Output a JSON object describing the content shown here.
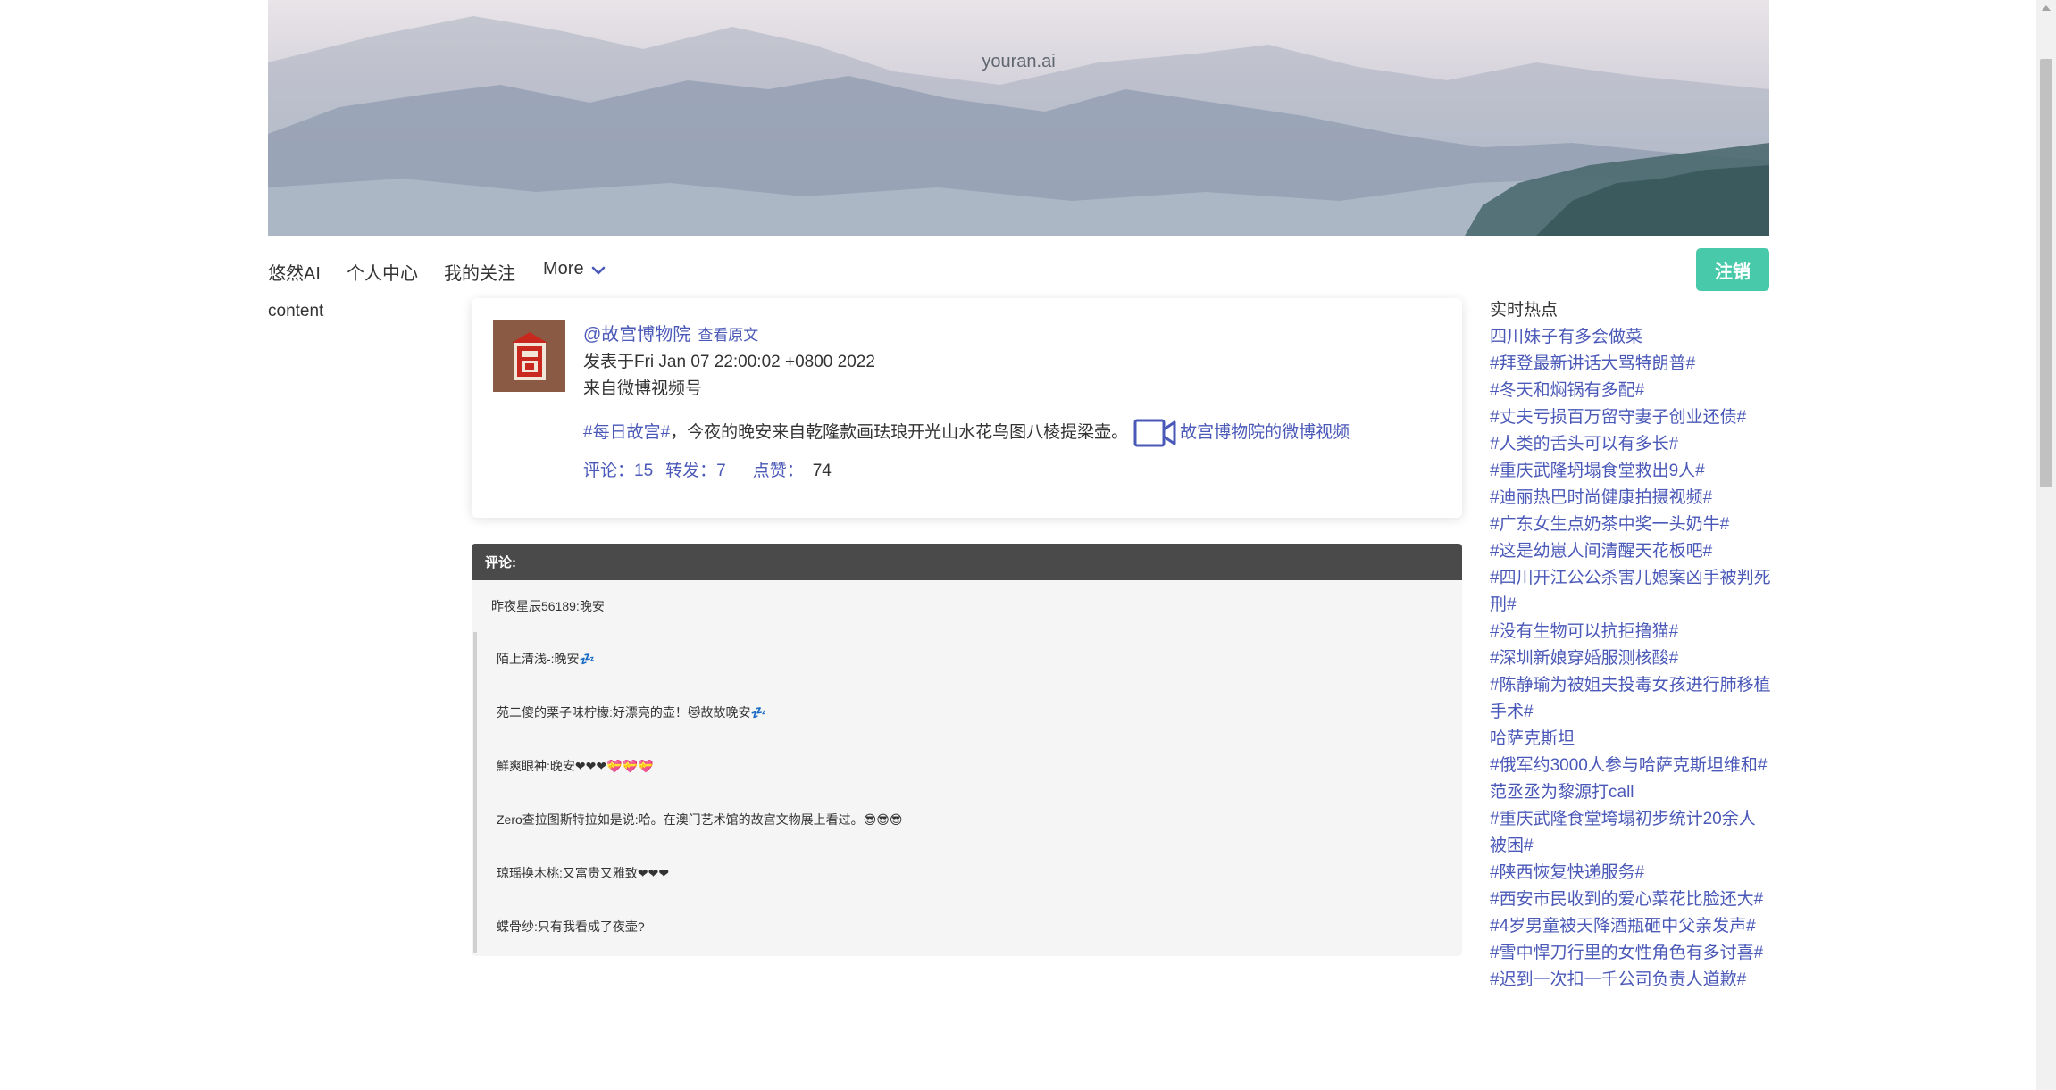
{
  "banner": {
    "title": "youran.ai"
  },
  "nav": {
    "items": [
      "悠然AI",
      "个人中心",
      "我的关注"
    ],
    "more_label": "More",
    "logout_label": "注销"
  },
  "left_label": "content",
  "post": {
    "author": "@故宫博物院",
    "view_original": "查看原文",
    "posted_at": "发表于Fri Jan 07 22:00:02 +0800 2022",
    "source": "来自微博视频号",
    "hashtag": "#每日故宫#",
    "text": "，今夜的晚安来自乾隆款画珐琅开光山水花鸟图八棱提梁壶。",
    "video_link": "故宫博物院的微博视频",
    "comments_label": "评论：15",
    "reposts_label": "转发：7",
    "likes_label": "点赞：",
    "likes_count": "74"
  },
  "comments": {
    "header": "评论:",
    "top": "昨夜星辰56189:晚安",
    "replies": [
      "陌上清浅-:晚安💤",
      "苑二傻的栗子味柠檬:好漂亮的壶！😻故故晚安💤",
      "鮮爽眼衶:晚安❤❤❤💝💝💝",
      "Zero查拉图斯特拉如是说:哈。在澳门艺术馆的故宫文物展上看过。😎😎😎",
      "琼瑶换木桃:又富贵又雅致❤❤❤",
      "蝶骨纱:只有我看成了夜壶?"
    ]
  },
  "sidebar": {
    "title": "实时热点",
    "items": [
      "四川妹子有多会做菜",
      "#拜登最新讲话大骂特朗普#",
      "#冬天和焖锅有多配#",
      "#丈夫亏损百万留守妻子创业还债#",
      "#人类的舌头可以有多长#",
      "#重庆武隆坍塌食堂救出9人#",
      "#迪丽热巴时尚健康拍摄视频#",
      "#广东女生点奶茶中奖一头奶牛#",
      "#这是幼崽人间清醒天花板吧#",
      "#四川开江公公杀害儿媳案凶手被判死刑#",
      "#没有生物可以抗拒撸猫#",
      "#深圳新娘穿婚服测核酸#",
      "#陈静瑜为被姐夫投毒女孩进行肺移植手术#",
      "哈萨克斯坦",
      "#俄军约3000人参与哈萨克斯坦维和#",
      "范丞丞为黎源打call",
      "#重庆武隆食堂垮塌初步统计20余人被困#",
      "#陕西恢复快递服务#",
      "#西安市民收到的爱心菜花比脸还大#",
      "#4岁男童被天降酒瓶砸中父亲发声#",
      "#雪中悍刀行里的女性角色有多讨喜#",
      "#迟到一次扣一千公司负责人道歉#"
    ]
  },
  "colors": {
    "accent": "#4a58b8",
    "logout": "#48c9a9",
    "comments_header": "#4a4a4a"
  },
  "icons": {
    "chevron": "chevron-down-icon",
    "video": "video-camera-icon",
    "avatar": "palace-museum-logo"
  }
}
